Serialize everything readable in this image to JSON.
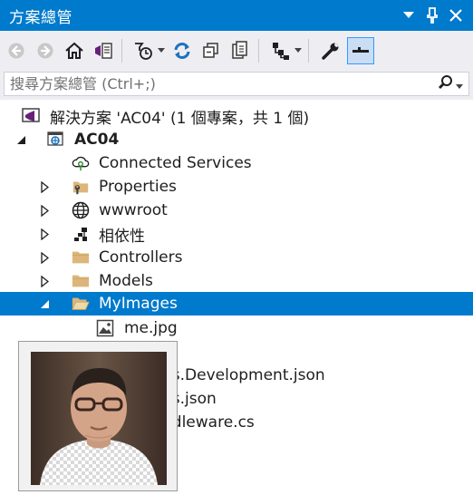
{
  "titlebar": {
    "title": "方案總管"
  },
  "search": {
    "placeholder": "搜尋方案總管 (Ctrl+;)"
  },
  "tree": {
    "solution": "解決方案 'AC04' (1 個專案，共 1 個)",
    "project": "AC04",
    "items": [
      {
        "label": "Connected Services",
        "icon": "connected-services-icon"
      },
      {
        "label": "Properties",
        "icon": "properties-folder-icon"
      },
      {
        "label": "wwwroot",
        "icon": "globe-icon"
      },
      {
        "label": "相依性",
        "icon": "dependencies-icon"
      },
      {
        "label": "Controllers",
        "icon": "folder-icon"
      },
      {
        "label": "Models",
        "icon": "folder-icon"
      },
      {
        "label": "MyImages",
        "icon": "open-folder-icon"
      },
      {
        "label": "me.jpg",
        "icon": "image-file-icon"
      }
    ],
    "partial_items": [
      "gs.Development.json",
      "gs.json",
      "ddleware.cs",
      "s"
    ]
  },
  "colors": {
    "accent": "#007acc",
    "toolbar_bg": "#eeeef2",
    "folder": "#dcb67a"
  }
}
